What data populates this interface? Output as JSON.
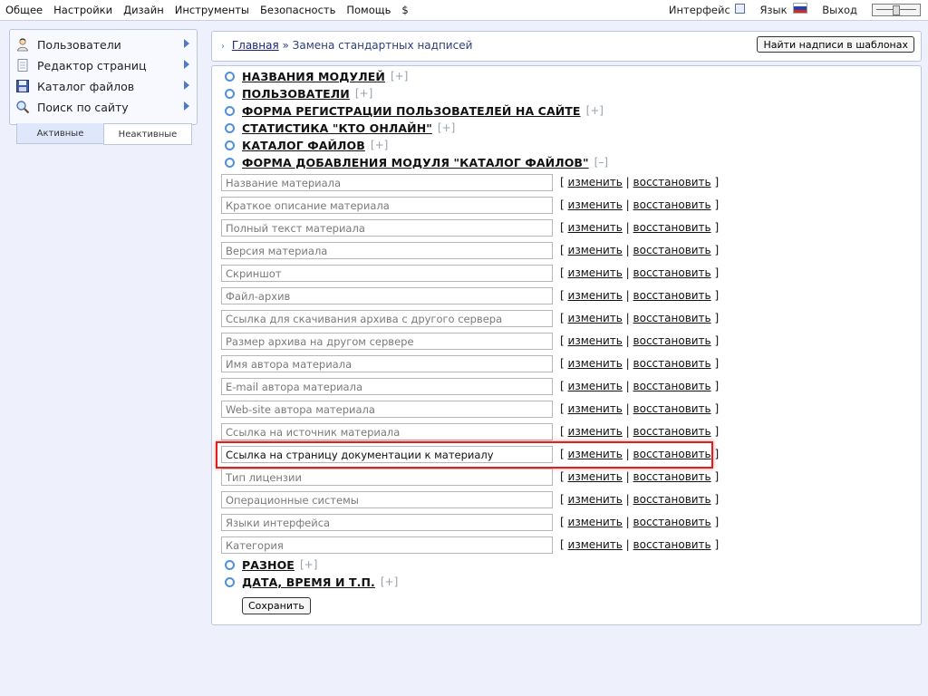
{
  "topbar": {
    "menu": [
      "Общее",
      "Настройки",
      "Дизайн",
      "Инструменты",
      "Безопасность",
      "Помощь",
      "$"
    ],
    "interface_label": "Интерфейс",
    "language_label": "Язык",
    "logout_label": "Выход"
  },
  "sidebar": {
    "items": [
      {
        "label": "Пользователи",
        "icon": "user-icon"
      },
      {
        "label": "Редактор страниц",
        "icon": "document-icon"
      },
      {
        "label": "Каталог файлов",
        "icon": "floppy-icon"
      },
      {
        "label": "Поиск по сайту",
        "icon": "magnifier-icon"
      }
    ],
    "tabs": {
      "active": "Активные",
      "inactive": "Неактивные"
    }
  },
  "breadcrumb": {
    "home": "Главная",
    "separator": "»",
    "current": "Замена стандартных надписей"
  },
  "buttons": {
    "find_in_templates": "Найти надписи в шаблонах",
    "save": "Сохранить"
  },
  "sections_top": [
    {
      "title": "НАЗВАНИЯ МОДУЛЕЙ",
      "toggle": "[+]"
    },
    {
      "title": "ПОЛЬЗОВАТЕЛИ",
      "toggle": "[+]"
    },
    {
      "title": "ФОРМА РЕГИСТРАЦИИ ПОЛЬЗОВАТЕЛЕЙ НА САЙТЕ",
      "toggle": "[+]"
    },
    {
      "title": "СТАТИСТИКА \"КТО ОНЛАЙН\"",
      "toggle": "[+]"
    },
    {
      "title": "КАТАЛОГ ФАЙЛОВ",
      "toggle": "[+]"
    },
    {
      "title": "ФОРМА ДОБАВЛЕНИЯ МОДУЛЯ \"КАТАЛОГ ФАЙЛОВ\"",
      "toggle": "[–]"
    }
  ],
  "actions": {
    "open": "[",
    "edit": "изменить",
    "sep": "|",
    "restore": "восстановить",
    "close": "]"
  },
  "fields": [
    "Название материала",
    "Краткое описание материала",
    "Полный текст материала",
    "Версия материала",
    "Скриншот",
    "Файл-архив",
    "Ссылка для скачивания архива с другого сервера",
    "Размер архива на другом сервере",
    "Имя автора материала",
    "E-mail автора материала",
    "Web-site автора материала",
    "Ссылка на источник материала",
    "Ссылка на страницу документации к материалу",
    "Тип лицензии",
    "Операционные системы",
    "Языки интерфейса",
    "Категория"
  ],
  "sections_bottom": [
    {
      "title": "РАЗНОЕ",
      "toggle": "[+]"
    },
    {
      "title": "ДАТА, ВРЕМЯ И Т.П.",
      "toggle": "[+]"
    }
  ],
  "colors": {
    "accent": "#4f79c9",
    "highlight_border": "#e02020",
    "background": "#eef1fb"
  }
}
